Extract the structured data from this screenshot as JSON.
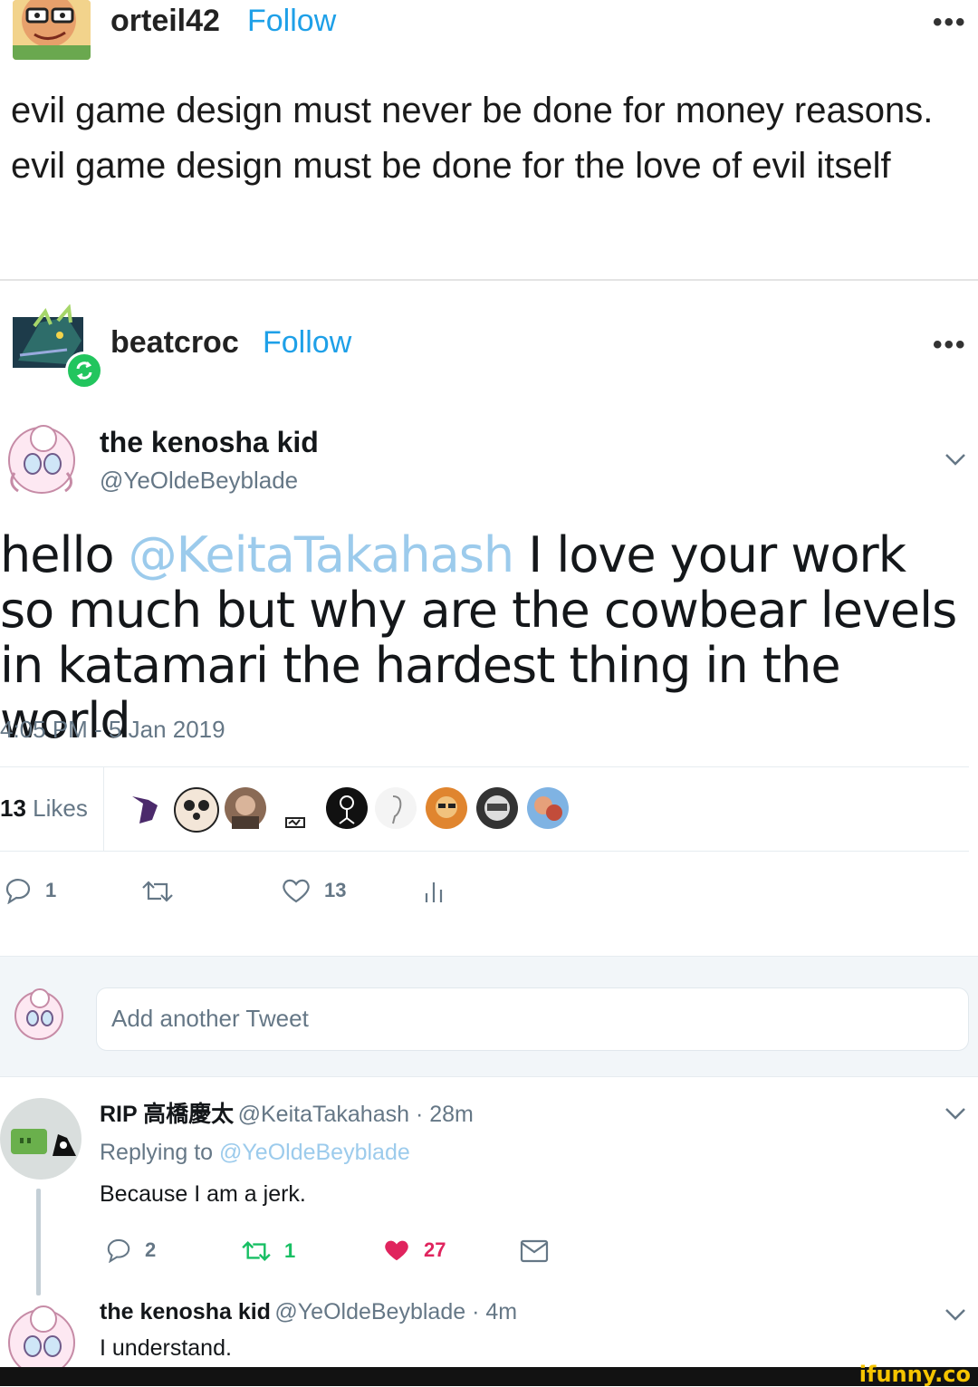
{
  "post1": {
    "username": "orteil42",
    "follow_label": "Follow",
    "more_label": "•••",
    "text": "evil game design must never be done for money reasons. evil game design must be done for the love of evil itself"
  },
  "post2": {
    "username": "beatcroc",
    "follow_label": "Follow",
    "more_label": "•••"
  },
  "tweet": {
    "name": "the kenosha kid",
    "handle": "@YeOldeBeyblade",
    "body_prefix": "hello ",
    "mention": "@KeitaTakahash",
    "body_suffix": " I love your work so much but why are the cowbear levels in katamari the hardest thing in the world",
    "timestamp": "4:05 PM - 5 Jan 2019",
    "likes_count": "13",
    "likes_label": " Likes",
    "replies": "1",
    "hearts": "13"
  },
  "compose": {
    "placeholder": "Add another Tweet"
  },
  "reply1": {
    "name": "RIP 高橋慶太",
    "handle_time": "@KeitaTakahash · 28m",
    "replying_prefix": "Replying to ",
    "replying_to": "@YeOldeBeyblade",
    "text": "Because I am a jerk.",
    "replies": "2",
    "retweets": "1",
    "likes": "27",
    "accent_retweet": "#17bf63",
    "accent_like": "#e0245e"
  },
  "reply2": {
    "name": "the kenosha kid",
    "handle_time": "@YeOldeBeyblade · 4m",
    "text": "I understand."
  },
  "watermark": "ifunny.co",
  "colors": {
    "follow": "#1ea0e8",
    "mention": "#9ccbec",
    "muted": "#657786"
  }
}
